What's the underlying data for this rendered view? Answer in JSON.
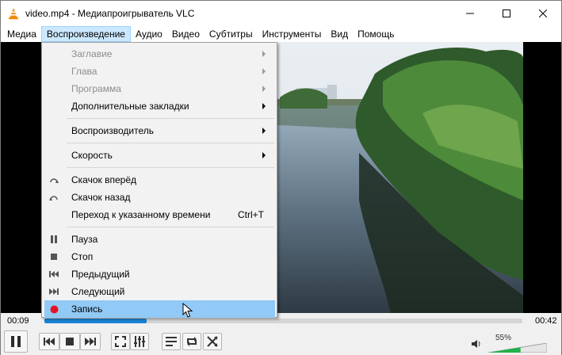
{
  "window": {
    "title": "video.mp4 - Медиапроигрыватель VLC"
  },
  "menubar": {
    "items": [
      "Медиа",
      "Воспроизведение",
      "Аудио",
      "Видео",
      "Субтитры",
      "Инструменты",
      "Вид",
      "Помощь"
    ],
    "active_index": 1
  },
  "playback_menu": {
    "items": [
      {
        "label": "Заглавие",
        "disabled": true,
        "submenu": true
      },
      {
        "label": "Глава",
        "disabled": true,
        "submenu": true
      },
      {
        "label": "Программа",
        "disabled": true,
        "submenu": true
      },
      {
        "label": "Дополнительные закладки",
        "disabled": false,
        "submenu": true
      },
      {
        "label": "Воспроизводитель",
        "disabled": false,
        "submenu": true
      },
      {
        "label": "Скорость",
        "disabled": false,
        "submenu": true
      },
      {
        "label": "Скачок вперёд",
        "icon": "jump-forward-icon"
      },
      {
        "label": "Скачок назад",
        "icon": "jump-backward-icon"
      },
      {
        "label": "Переход к указанному времени",
        "shortcut": "Ctrl+T"
      },
      {
        "label": "Пауза",
        "icon": "pause-icon"
      },
      {
        "label": "Стоп",
        "icon": "stop-icon"
      },
      {
        "label": "Предыдущий",
        "icon": "previous-icon"
      },
      {
        "label": "Следующий",
        "icon": "next-icon"
      },
      {
        "label": "Запись",
        "icon": "record-icon",
        "highlighted": true
      }
    ]
  },
  "player": {
    "time_elapsed": "00:09",
    "time_total": "00:42",
    "progress": 0.214,
    "volume_label": "55%",
    "volume": 0.55
  },
  "colors": {
    "accent": "#1a83d4",
    "menu_highlight": "#91c9f7",
    "menubar_active": "#cce8ff",
    "record": "#e81123",
    "volume_green": "#22b14c"
  }
}
